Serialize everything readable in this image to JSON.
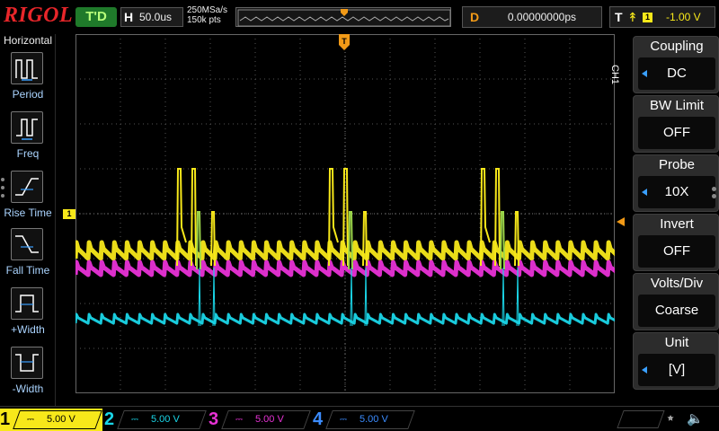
{
  "top": {
    "brand": "RIGOL",
    "run_status": "T'D",
    "horizontal_label": "H",
    "timebase": "50.0us",
    "sample_rate": "250MSa/s",
    "memory_depth": "150k pts",
    "delay_label": "D",
    "delay_value": "0.00000000ps",
    "trigger_label": "T",
    "trigger_source": "1",
    "trigger_level": "-1.00 V"
  },
  "left_menu": {
    "title": "Horizontal",
    "items": [
      {
        "label": "Period",
        "icon": "period-icon"
      },
      {
        "label": "Freq",
        "icon": "freq-icon"
      },
      {
        "label": "Rise Time",
        "icon": "rise-time-icon"
      },
      {
        "label": "Fall Time",
        "icon": "fall-time-icon"
      },
      {
        "label": "+Width",
        "icon": "plus-width-icon"
      },
      {
        "label": "-Width",
        "icon": "minus-width-icon"
      }
    ]
  },
  "right_menu": {
    "channel_tab": "CH1",
    "items": [
      {
        "title": "Coupling",
        "value": "DC",
        "has_arrow": true
      },
      {
        "title": "BW Limit",
        "value": "OFF",
        "has_arrow": false
      },
      {
        "title": "Probe",
        "value": "10X",
        "has_arrow": true
      },
      {
        "title": "Invert",
        "value": "OFF",
        "has_arrow": false
      },
      {
        "title": "Volts/Div",
        "value": "Coarse",
        "has_arrow": false
      },
      {
        "title": "Unit",
        "value": "[V]",
        "has_arrow": true
      }
    ]
  },
  "channels": [
    {
      "num": "1",
      "coupling": "DC",
      "scale": "5.00 V",
      "color": "#f7e81a"
    },
    {
      "num": "2",
      "coupling": "DC",
      "scale": "5.00 V",
      "color": "#1ad6e8"
    },
    {
      "num": "3",
      "coupling": "DC",
      "scale": "5.00 V",
      "color": "#e832d6"
    },
    {
      "num": "4",
      "coupling": "DC",
      "scale": "5.00 V",
      "color": "#3b8cff"
    }
  ],
  "markers": {
    "ch1_ground": "1",
    "trigger_pos": "T"
  },
  "colors": {
    "grid": "#555555",
    "brand": "#e8262a",
    "accent": "#f29a17"
  }
}
